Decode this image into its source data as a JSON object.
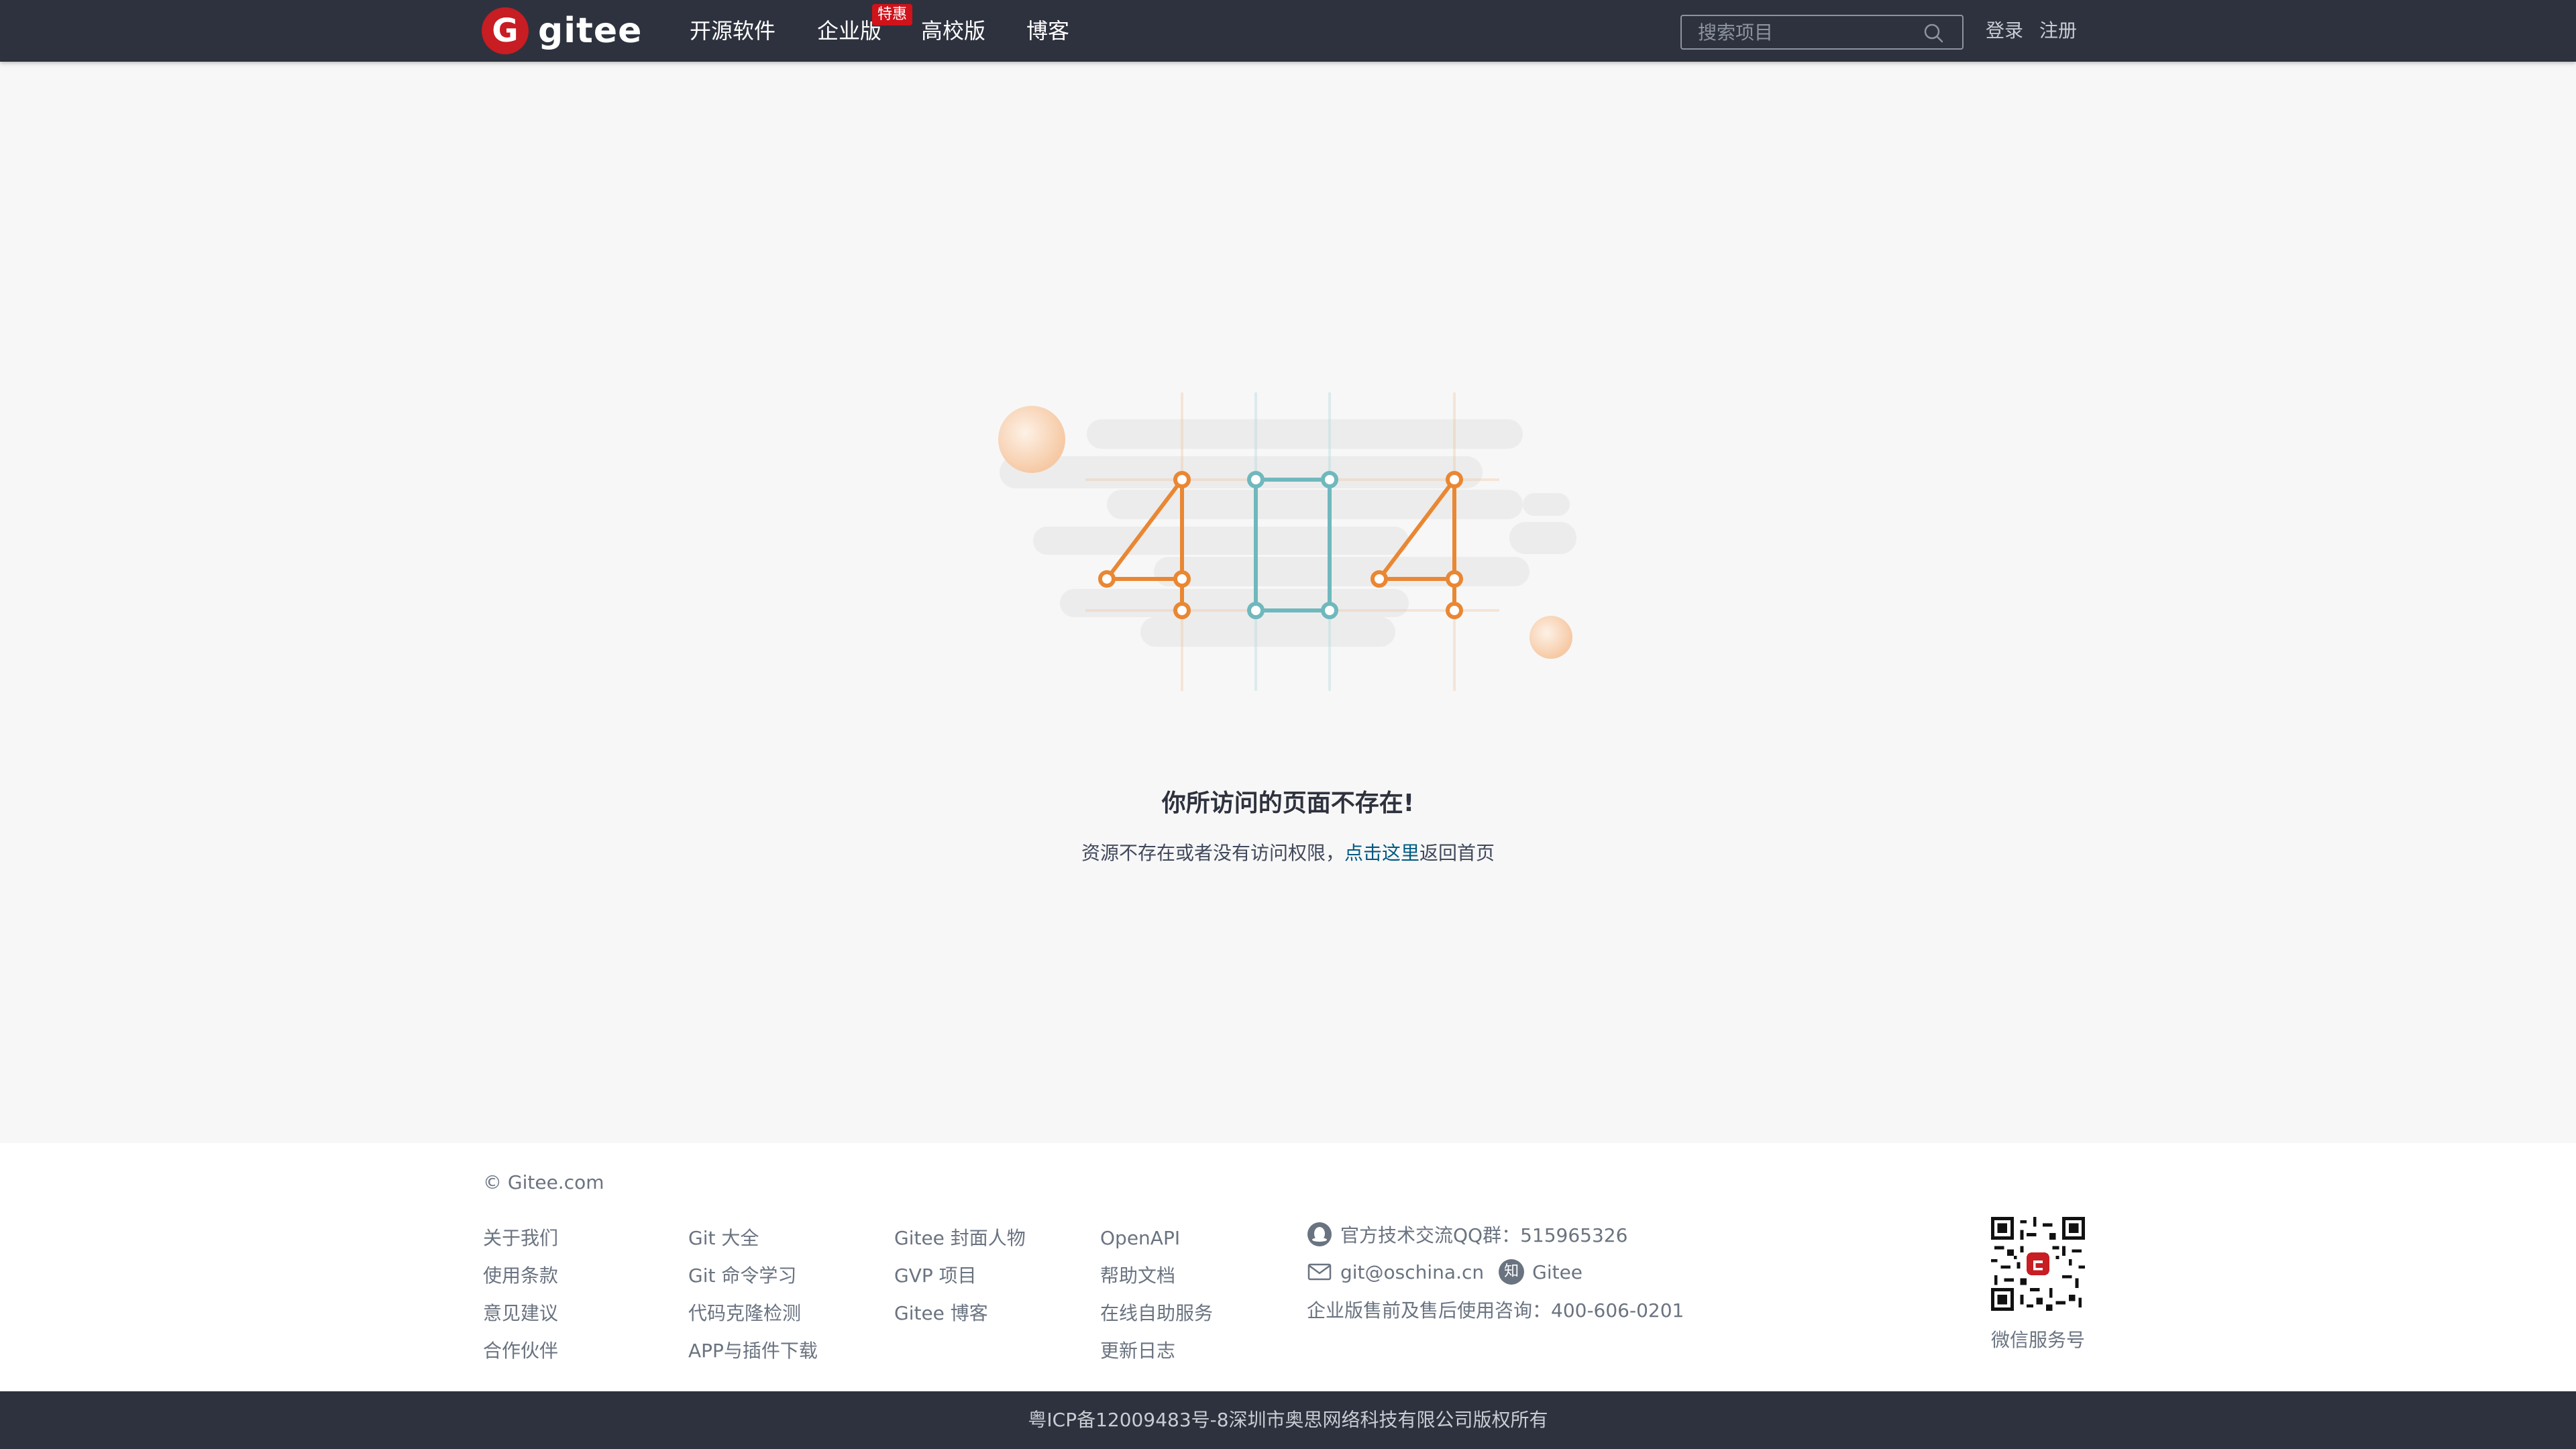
{
  "header": {
    "brand": "gitee",
    "logo_glyph": "G",
    "nav": [
      {
        "label": "开源软件"
      },
      {
        "label": "企业版",
        "badge": "特惠"
      },
      {
        "label": "高校版"
      },
      {
        "label": "博客"
      }
    ],
    "search_placeholder": "搜索项目",
    "login": "登录",
    "register": "注册"
  },
  "main": {
    "illustration_digits": "404",
    "title": "你所访问的页面不存在!",
    "desc_prefix": "资源不存在或者没有访问权限，",
    "desc_link": "点击这里",
    "desc_suffix": "返回首页"
  },
  "footer": {
    "copyright": "© Gitee.com",
    "columns": [
      [
        "关于我们",
        "使用条款",
        "意见建议",
        "合作伙伴"
      ],
      [
        "Git 大全",
        "Git 命令学习",
        "代码克隆检测",
        "APP与插件下载"
      ],
      [
        "Gitee 封面人物",
        "GVP 项目",
        "Gitee 博客"
      ],
      [
        "OpenAPI",
        "帮助文档",
        "在线自助服务",
        "更新日志"
      ]
    ],
    "qq_label": "官方技术交流QQ群：515965326",
    "email": "git@oschina.cn",
    "zhihu_label": "Gitee",
    "zhihu_glyph": "知",
    "consult": "企业版售前及售后使用咨询：400-606-0201",
    "qr_label": "微信服务号",
    "icp": "粤ICP备12009483号-8深圳市奥思网络科技有限公司版权所有"
  },
  "colors": {
    "header_bg": "#2e323e",
    "brand_red": "#c71d23",
    "digit_orange": "#e98733",
    "digit_teal": "#6fb8bd",
    "link_blue": "#005980"
  }
}
